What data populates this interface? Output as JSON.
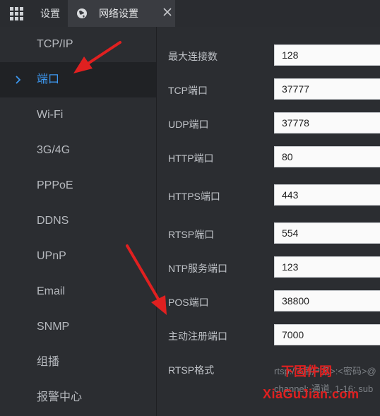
{
  "header": {
    "settings_tab": "设置",
    "network_tab": "网络设置"
  },
  "sidebar": {
    "items": [
      {
        "label": "TCP/IP"
      },
      {
        "label": "端口",
        "active": true
      },
      {
        "label": "Wi-Fi"
      },
      {
        "label": "3G/4G"
      },
      {
        "label": "PPPoE"
      },
      {
        "label": "DDNS"
      },
      {
        "label": "UPnP"
      },
      {
        "label": "Email"
      },
      {
        "label": "SNMP"
      },
      {
        "label": "组播"
      },
      {
        "label": "报警中心"
      }
    ]
  },
  "form": {
    "rows": [
      {
        "label": "最大连接数",
        "value": "128"
      },
      {
        "label": "TCP端口",
        "value": "37777"
      },
      {
        "label": "UDP端口",
        "value": "37778"
      },
      {
        "label": "HTTP端口",
        "value": "80"
      },
      {
        "label": "HTTPS端口",
        "value": "443"
      },
      {
        "label": "RTSP端口",
        "value": "554"
      },
      {
        "label": "NTP服务端口",
        "value": "123"
      },
      {
        "label": "POS端口",
        "value": "38800"
      },
      {
        "label": "主动注册端口",
        "value": "7000"
      }
    ],
    "rtsp_format_label": "RTSP格式",
    "rtsp_line1": "rtsp://<用户名>:<密码>@",
    "rtsp_line2": "channel: 通道, 1-16; sub"
  },
  "watermark": {
    "top": "下固件网",
    "bottom": "XiaGuJian.com"
  },
  "colors": {
    "accent": "#3d98f0",
    "annotation": "#e02020"
  }
}
